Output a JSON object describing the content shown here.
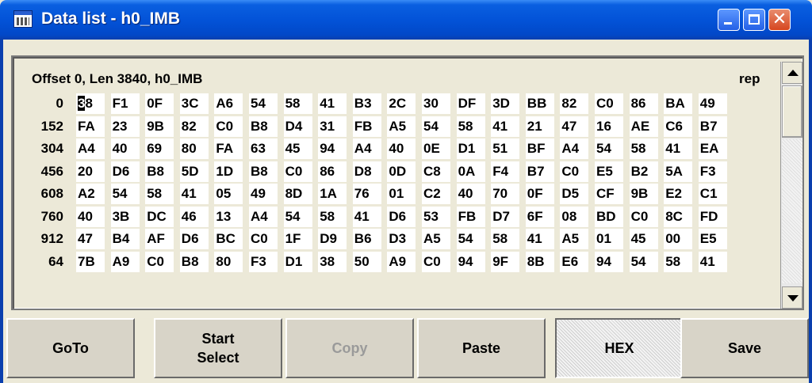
{
  "window": {
    "title": "Data list - h0_IMB"
  },
  "header": {
    "info": "Offset 0, Len 3840,   h0_IMB",
    "mode": "rep"
  },
  "rows": [
    {
      "offset": "0",
      "bytes": [
        "38",
        "F1",
        "0F",
        "3C",
        "A6",
        "54",
        "58",
        "41",
        "B3",
        "2C",
        "30",
        "DF",
        "3D",
        "BB",
        "82",
        "C0",
        "86",
        "BA",
        "49"
      ]
    },
    {
      "offset": "152",
      "bytes": [
        "FA",
        "23",
        "9B",
        "82",
        "C0",
        "B8",
        "D4",
        "31",
        "FB",
        "A5",
        "54",
        "58",
        "41",
        "21",
        "47",
        "16",
        "AE",
        "C6",
        "B7"
      ]
    },
    {
      "offset": "304",
      "bytes": [
        "A4",
        "40",
        "69",
        "80",
        "FA",
        "63",
        "45",
        "94",
        "A4",
        "40",
        "0E",
        "D1",
        "51",
        "BF",
        "A4",
        "54",
        "58",
        "41",
        "EA"
      ]
    },
    {
      "offset": "456",
      "bytes": [
        "20",
        "D6",
        "B8",
        "5D",
        "1D",
        "B8",
        "C0",
        "86",
        "D8",
        "0D",
        "C8",
        "0A",
        "F4",
        "B7",
        "C0",
        "E5",
        "B2",
        "5A",
        "F3"
      ]
    },
    {
      "offset": "608",
      "bytes": [
        "A2",
        "54",
        "58",
        "41",
        "05",
        "49",
        "8D",
        "1A",
        "76",
        "01",
        "C2",
        "40",
        "70",
        "0F",
        "D5",
        "CF",
        "9B",
        "E2",
        "C1"
      ]
    },
    {
      "offset": "760",
      "bytes": [
        "40",
        "3B",
        "DC",
        "46",
        "13",
        "A4",
        "54",
        "58",
        "41",
        "D6",
        "53",
        "FB",
        "D7",
        "6F",
        "08",
        "BD",
        "C0",
        "8C",
        "FD"
      ]
    },
    {
      "offset": "912",
      "bytes": [
        "47",
        "B4",
        "AF",
        "D6",
        "BC",
        "C0",
        "1F",
        "D9",
        "B6",
        "D3",
        "A5",
        "54",
        "58",
        "41",
        "A5",
        "01",
        "45",
        "00",
        "E5"
      ]
    },
    {
      "offset": "64",
      "bytes": [
        "7B",
        "A9",
        "C0",
        "B8",
        "80",
        "F3",
        "D1",
        "38",
        "50",
        "A9",
        "C0",
        "94",
        "9F",
        "8B",
        "E6",
        "94",
        "54",
        "58",
        "41"
      ]
    }
  ],
  "cursor": {
    "row": 0,
    "col": 0,
    "char": 0
  },
  "buttons": {
    "goto": "GoTo",
    "start_select_line1": "Start",
    "start_select_line2": "Select",
    "copy": "Copy",
    "paste": "Paste",
    "hex": "HEX",
    "save": "Save"
  },
  "colors": {
    "title_bar": "#0353d8",
    "panel_bg": "#ece9d8",
    "cell_bg": "#ffffff"
  }
}
